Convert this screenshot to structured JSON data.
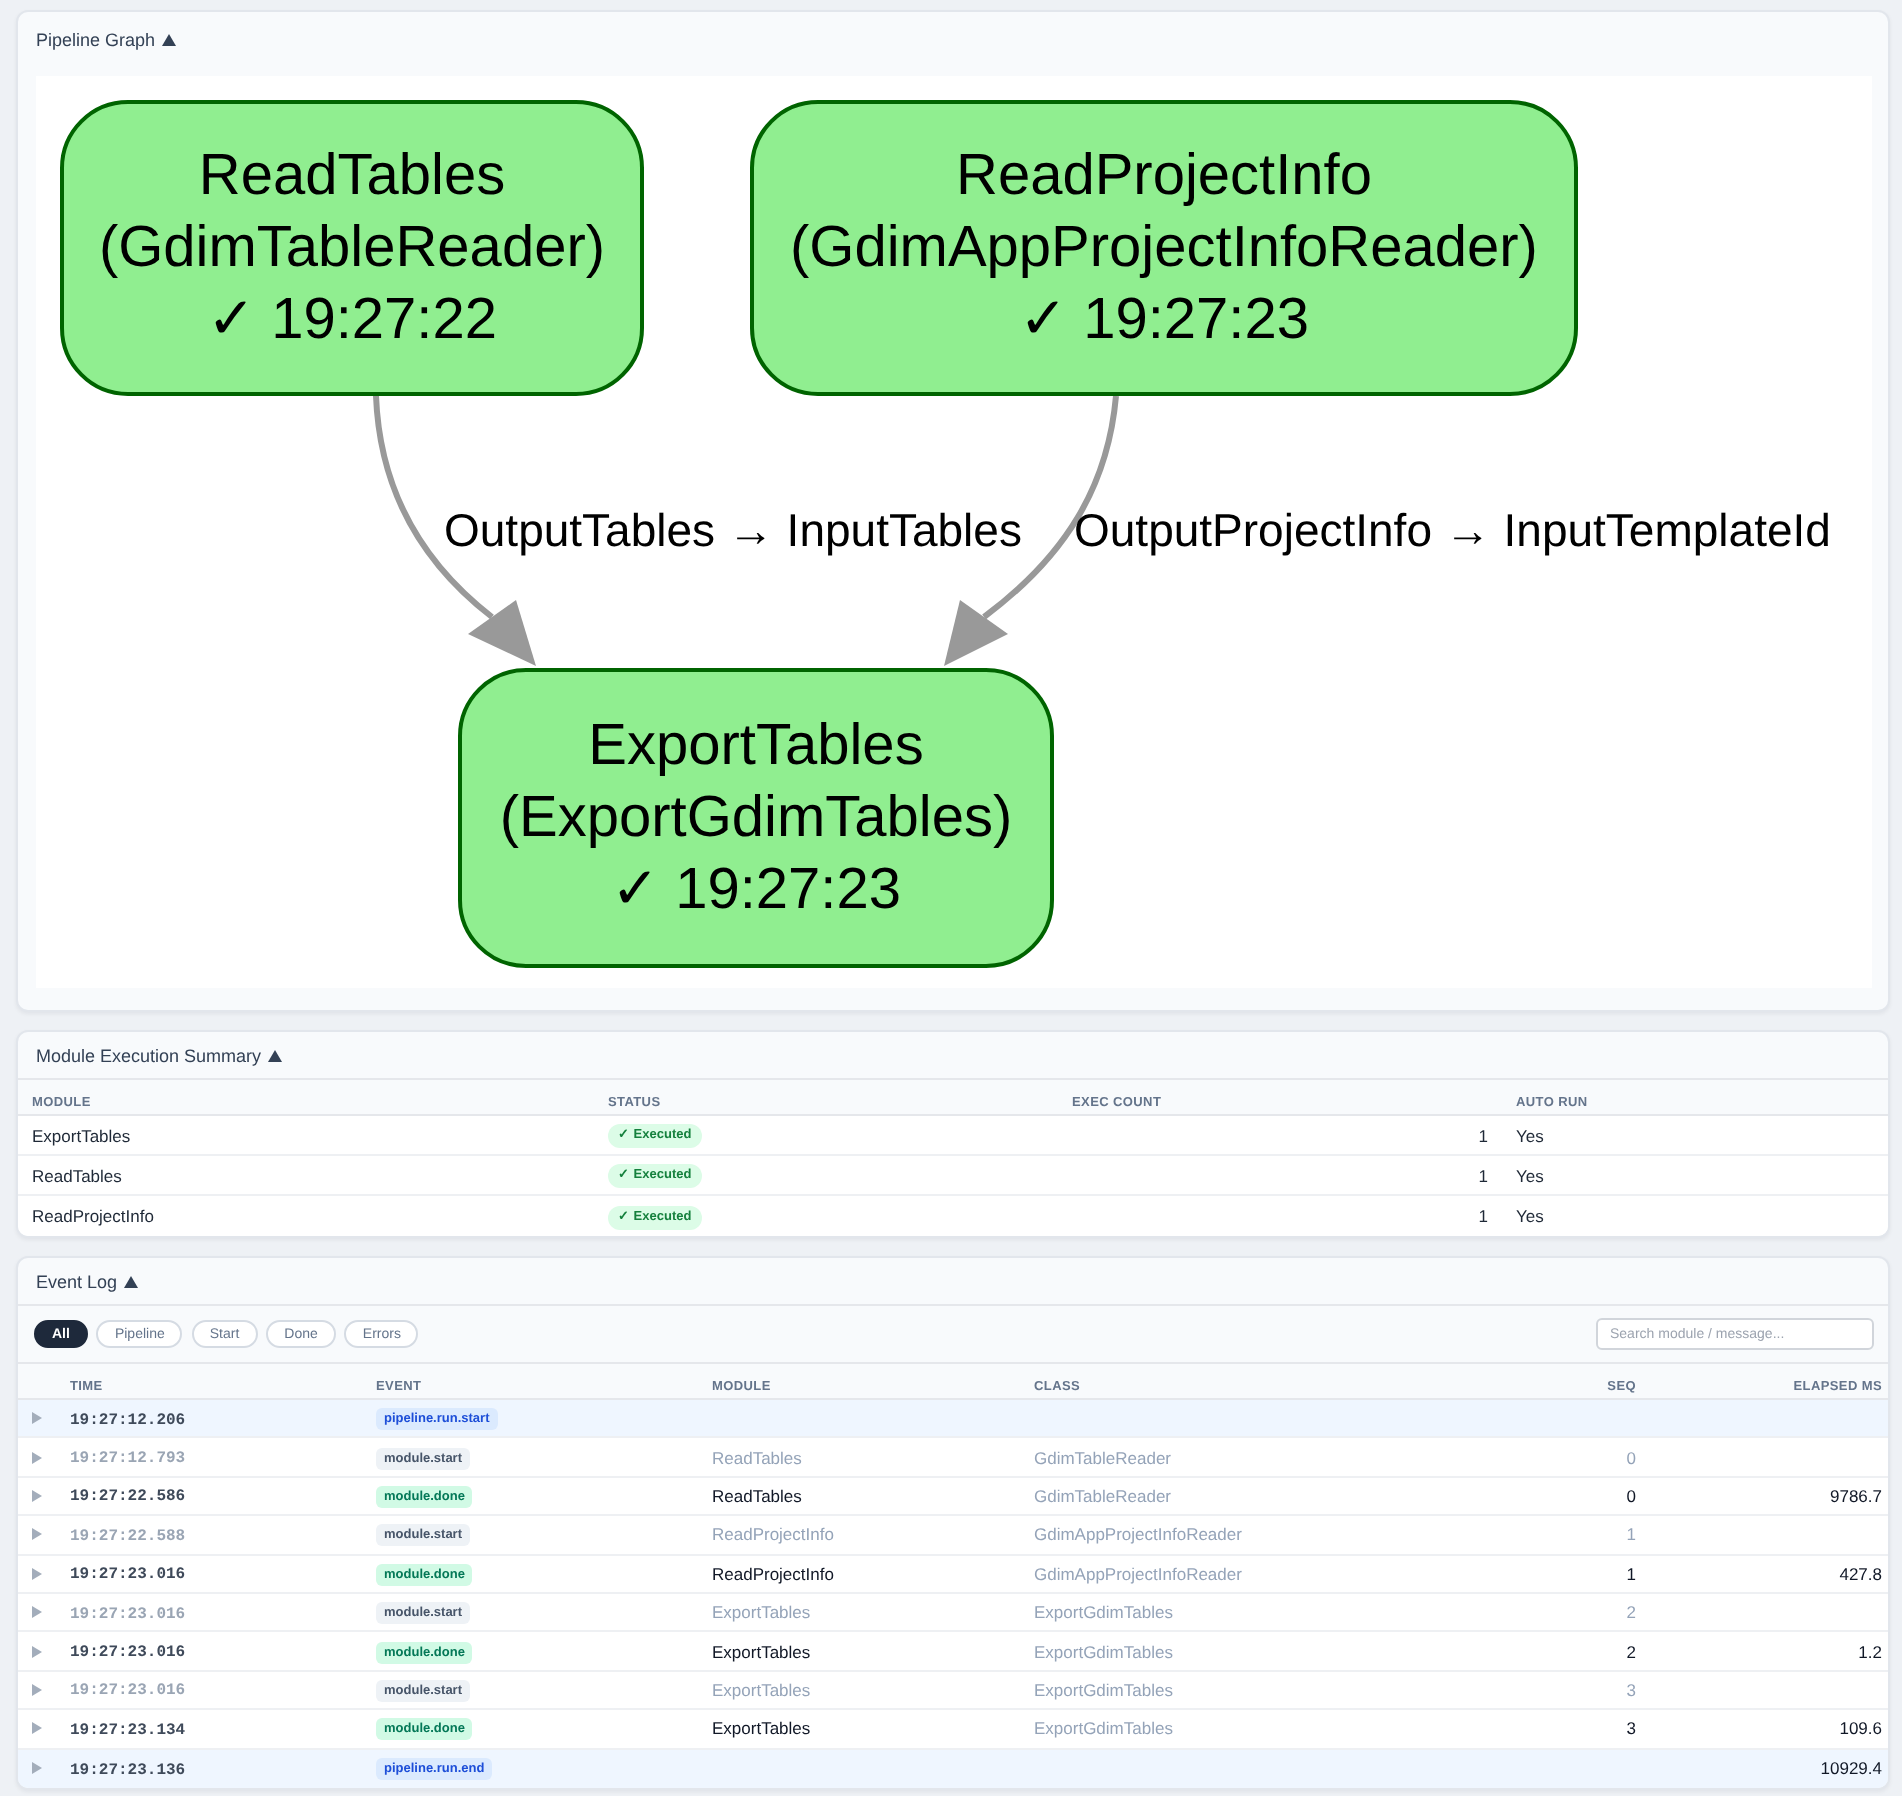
{
  "pipeline_graph": {
    "title": "Pipeline Graph",
    "expanded": true,
    "nodes": [
      {
        "name": "ReadTables",
        "class": "(GdimTableReader)",
        "status": "✓ 19:27:22",
        "completed": true
      },
      {
        "name": "ReadProjectInfo",
        "class": "(GdimAppProjectInfoReader)",
        "status": "✓ 19:27:23",
        "completed": true
      },
      {
        "name": "ExportTables",
        "class": "(ExportGdimTables)",
        "status": "✓ 19:27:23",
        "completed": true
      }
    ],
    "edges": [
      {
        "label": "OutputTables → InputTables"
      },
      {
        "label": "OutputProjectInfo → InputTemplateId"
      }
    ]
  },
  "module_summary": {
    "title": "Module Execution Summary",
    "expanded": true,
    "columns": [
      "MODULE",
      "STATUS",
      "EXEC COUNT",
      "AUTO RUN"
    ],
    "rows": [
      {
        "module": "ExportTables",
        "status": "✓ Executed",
        "exec_count": "1",
        "auto_run": "Yes"
      },
      {
        "module": "ReadTables",
        "status": "✓ Executed",
        "exec_count": "1",
        "auto_run": "Yes"
      },
      {
        "module": "ReadProjectInfo",
        "status": "✓ Executed",
        "exec_count": "1",
        "auto_run": "Yes"
      }
    ]
  },
  "event_log": {
    "title": "Event Log",
    "expanded": true,
    "filters": [
      {
        "label": "All",
        "selected": true
      },
      {
        "label": "Pipeline",
        "selected": false
      },
      {
        "label": "Start",
        "selected": false
      },
      {
        "label": "Done",
        "selected": false
      },
      {
        "label": "Errors",
        "selected": false
      }
    ],
    "search": {
      "placeholder": "Search module / message..."
    },
    "columns": [
      "TIME",
      "EVENT",
      "MODULE",
      "CLASS",
      "SEQ",
      "ELAPSED MS"
    ],
    "rows": [
      {
        "kind": "pipeline",
        "expanded": false,
        "time": "19:27:12.206",
        "event": "pipeline.run.start"
      },
      {
        "kind": "start",
        "expanded": false,
        "time": "19:27:12.793",
        "event": "module.start",
        "module": "ReadTables",
        "class": "GdimTableReader",
        "seq": "0"
      },
      {
        "kind": "done",
        "expanded": false,
        "time": "19:27:22.586",
        "event": "module.done",
        "module": "ReadTables",
        "class": "GdimTableReader",
        "seq": "0",
        "elapsed_ms": "9786.7"
      },
      {
        "kind": "start",
        "expanded": false,
        "time": "19:27:22.588",
        "event": "module.start",
        "module": "ReadProjectInfo",
        "class": "GdimAppProjectInfoReader",
        "seq": "1"
      },
      {
        "kind": "done",
        "expanded": false,
        "time": "19:27:23.016",
        "event": "module.done",
        "module": "ReadProjectInfo",
        "class": "GdimAppProjectInfoReader",
        "seq": "1",
        "elapsed_ms": "427.8"
      },
      {
        "kind": "start",
        "expanded": false,
        "time": "19:27:23.016",
        "event": "module.start",
        "module": "ExportTables",
        "class": "ExportGdimTables",
        "seq": "2"
      },
      {
        "kind": "done",
        "expanded": false,
        "time": "19:27:23.016",
        "event": "module.done",
        "module": "ExportTables",
        "class": "ExportGdimTables",
        "seq": "2",
        "elapsed_ms": "1.2"
      },
      {
        "kind": "start",
        "expanded": false,
        "time": "19:27:23.016",
        "event": "module.start",
        "module": "ExportTables",
        "class": "ExportGdimTables",
        "seq": "3"
      },
      {
        "kind": "done",
        "expanded": false,
        "time": "19:27:23.134",
        "event": "module.done",
        "module": "ExportTables",
        "class": "ExportGdimTables",
        "seq": "3",
        "elapsed_ms": "109.6"
      },
      {
        "kind": "pipeline",
        "expanded": false,
        "time": "19:27:23.136",
        "event": "pipeline.run.end",
        "elapsed_ms": "10929.4"
      }
    ]
  }
}
